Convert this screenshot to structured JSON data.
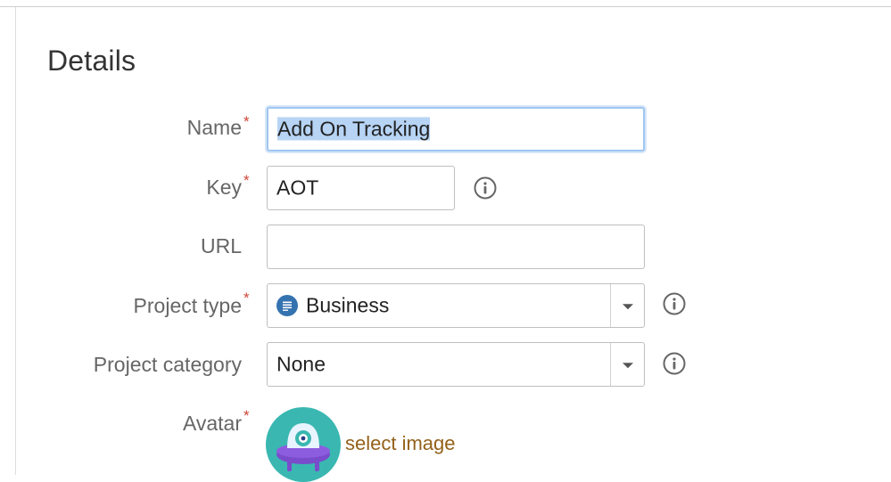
{
  "section": {
    "title": "Details"
  },
  "form": {
    "name": {
      "label": "Name",
      "required": "*",
      "value": "Add On Tracking"
    },
    "key": {
      "label": "Key",
      "required": "*",
      "value": "AOT"
    },
    "url": {
      "label": "URL",
      "value": ""
    },
    "project_type": {
      "label": "Project type",
      "required": "*",
      "value": "Business",
      "icon": "business-project-icon"
    },
    "project_category": {
      "label": "Project category",
      "value": "None"
    },
    "avatar": {
      "label": "Avatar",
      "required": "*",
      "link_text": "select image"
    }
  },
  "colors": {
    "required_star": "#d04437",
    "focus_border": "#9fc6f2",
    "selection": "#b7d4f5",
    "link": "#94611a",
    "business_icon": "#3572b0",
    "avatar_bg": "#3ab7b1",
    "avatar_body": "#7a4ccc"
  },
  "icons": {
    "info": "info-circle-icon",
    "dropdown": "chevron-down-icon"
  }
}
